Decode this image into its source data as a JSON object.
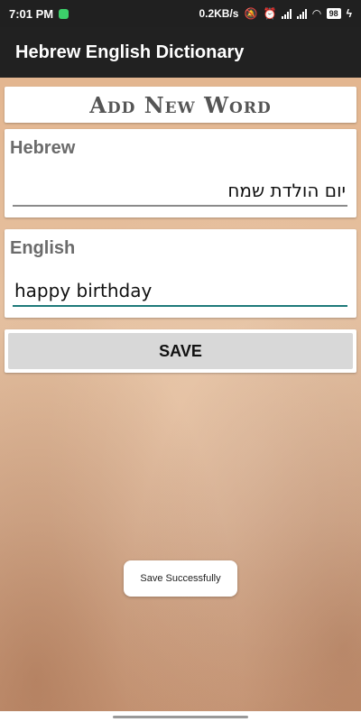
{
  "status_bar": {
    "time": "7:01 PM",
    "network_speed": "0.2KB/s",
    "battery": "98",
    "icons": [
      "notification-app-icon",
      "mute-icon",
      "alarm-icon",
      "signal-icon",
      "signal-icon",
      "wifi-icon",
      "battery-icon",
      "charging-icon"
    ]
  },
  "app_bar": {
    "title": "Hebrew English Dictionary"
  },
  "form": {
    "heading": "Add New Word",
    "hebrew_label": "Hebrew",
    "hebrew_value": "יום הולדת שמח",
    "english_label": "English",
    "english_value": "happy birthday",
    "save_label": "SAVE"
  },
  "toast": {
    "message": "Save Successfully"
  },
  "colors": {
    "app_bar": "#212121",
    "status_bar": "#202020",
    "active_underline": "#1e7a7a",
    "button_bg": "#d8d8d8"
  }
}
